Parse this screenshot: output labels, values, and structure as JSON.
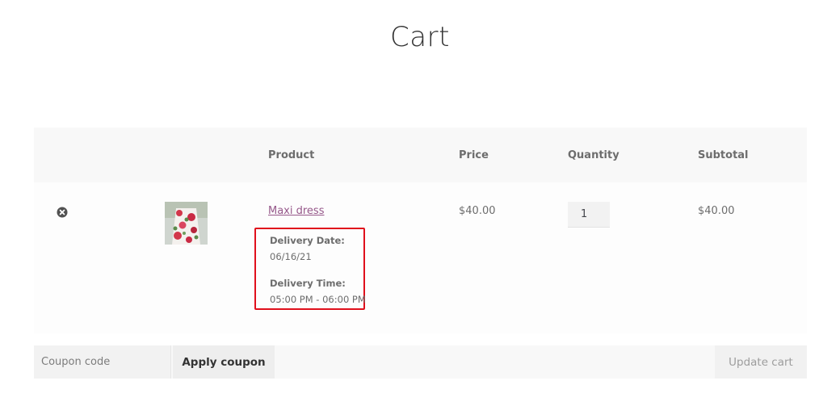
{
  "page": {
    "title": "Cart"
  },
  "cart": {
    "headers": {
      "product": "Product",
      "price": "Price",
      "quantity": "Quantity",
      "subtotal": "Subtotal"
    },
    "items": [
      {
        "name": "Maxi dress",
        "price": "$40.00",
        "quantity": "1",
        "subtotal": "$40.00",
        "meta": [
          {
            "label": "Delivery Date:",
            "value": "06/16/21"
          },
          {
            "label": "Delivery Time:",
            "value": "05:00 PM - 06:00 PM"
          }
        ]
      }
    ]
  },
  "actions": {
    "coupon_placeholder": "Coupon code",
    "apply_coupon_label": "Apply coupon",
    "update_cart_label": "Update cart"
  },
  "colors": {
    "link": "#96588a",
    "highlight_box": "#e0101c",
    "header_bg": "#f8f8f8"
  },
  "icons": {
    "remove": "remove-circle-x-icon"
  }
}
